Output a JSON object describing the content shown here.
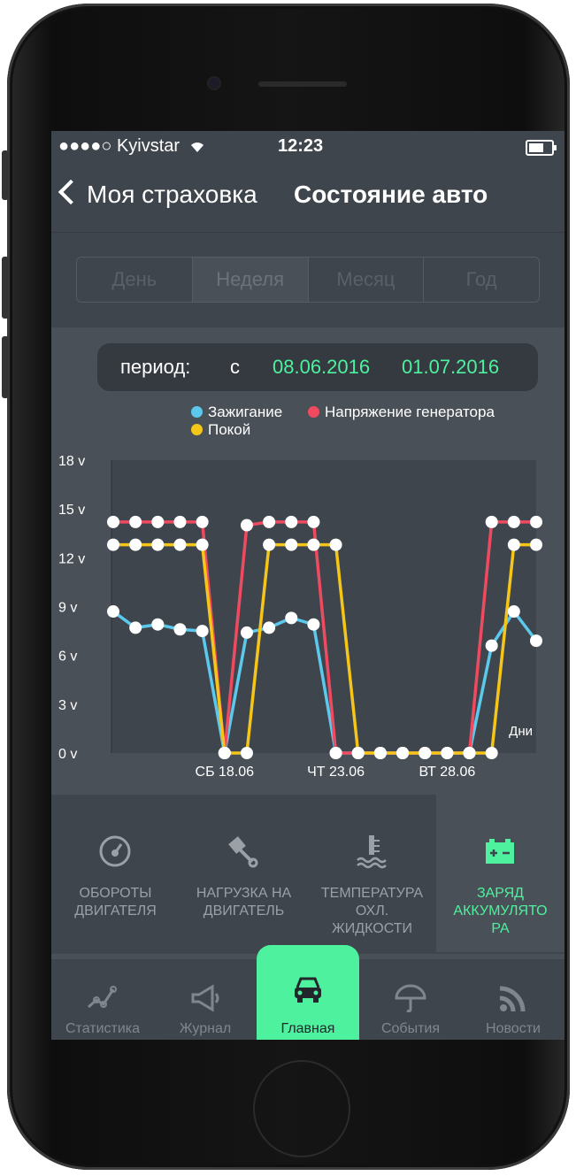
{
  "status_bar": {
    "carrier": "●●●●○ Kyivstar",
    "time": "12:23"
  },
  "nav": {
    "back_label": "Моя страховка",
    "title": "Состояние авто"
  },
  "segments": [
    {
      "label": "День",
      "active": false
    },
    {
      "label": "Неделя",
      "active": true
    },
    {
      "label": "Месяц",
      "active": false
    },
    {
      "label": "Год",
      "active": false
    }
  ],
  "period": {
    "label": "период:",
    "from_prefix": "с",
    "from": "08.06.2016",
    "to": "01.07.2016"
  },
  "colors": {
    "accent": "#4df19e",
    "ignition": "#5bc8ec",
    "voltage": "#f04a60",
    "rest": "#f5c518"
  },
  "chart_data": {
    "type": "line",
    "ylabel": "",
    "xlabel": "Дни",
    "ylim": [
      0,
      18
    ],
    "yticks": [
      "18 v",
      "15 v",
      "12 v",
      "9 v",
      "6 v",
      "3 v",
      "0 v"
    ],
    "xtick_labels": [
      "СБ 18.06",
      "ЧТ 23.06",
      "ВТ 28.06"
    ],
    "x": [
      13,
      14,
      15,
      16,
      17,
      18,
      19,
      20,
      21,
      22,
      23,
      24,
      25,
      26,
      27,
      28,
      29,
      30,
      31,
      32
    ],
    "series": [
      {
        "name": "Зажигание",
        "color": "#5bc8ec",
        "values": [
          8.7,
          7.7,
          7.9,
          7.6,
          7.5,
          0,
          7.4,
          7.7,
          8.3,
          7.9,
          0,
          0,
          0,
          0,
          0,
          0,
          0,
          6.6,
          8.7,
          6.9
        ]
      },
      {
        "name": "Напряжение генератора",
        "color": "#f04a60",
        "values": [
          14.2,
          14.2,
          14.2,
          14.2,
          14.2,
          0,
          14.0,
          14.2,
          14.2,
          14.2,
          0,
          0,
          0,
          0,
          0,
          0,
          0,
          14.2,
          14.2,
          14.2
        ]
      },
      {
        "name": "Покой",
        "color": "#f5c518",
        "values": [
          12.8,
          12.8,
          12.8,
          12.8,
          12.8,
          0,
          0,
          12.8,
          12.8,
          12.8,
          12.8,
          0,
          0,
          0,
          0,
          0,
          0,
          0,
          12.8,
          12.8
        ]
      }
    ]
  },
  "cards": [
    {
      "line1": "ОБОРОТЫ",
      "line2": "ДВИГАТЕЛЯ",
      "line3": "",
      "icon": "speedometer-icon",
      "active": false
    },
    {
      "line1": "НАГРУЗКА НА",
      "line2": "ДВИГАТЕЛЬ",
      "line3": "",
      "icon": "piston-icon",
      "active": false
    },
    {
      "line1": "ТЕМПЕРАТУРА",
      "line2": "ОХЛ.",
      "line3": "ЖИДКОСТИ",
      "icon": "coolant-temperature-icon",
      "active": false
    },
    {
      "line1": "ЗАРЯД",
      "line2": "АККУМУЛЯТО",
      "line3": "РА",
      "icon": "battery-charge-icon",
      "active": true
    }
  ],
  "tabs": [
    {
      "label": "Статистика",
      "icon": "statistics-icon",
      "active": false
    },
    {
      "label": "Журнал",
      "icon": "megaphone-icon",
      "active": false
    },
    {
      "label": "Главная",
      "icon": "car-icon",
      "active": true
    },
    {
      "label": "События",
      "icon": "umbrella-icon",
      "active": false
    },
    {
      "label": "Новости",
      "icon": "rss-icon",
      "active": false
    }
  ]
}
